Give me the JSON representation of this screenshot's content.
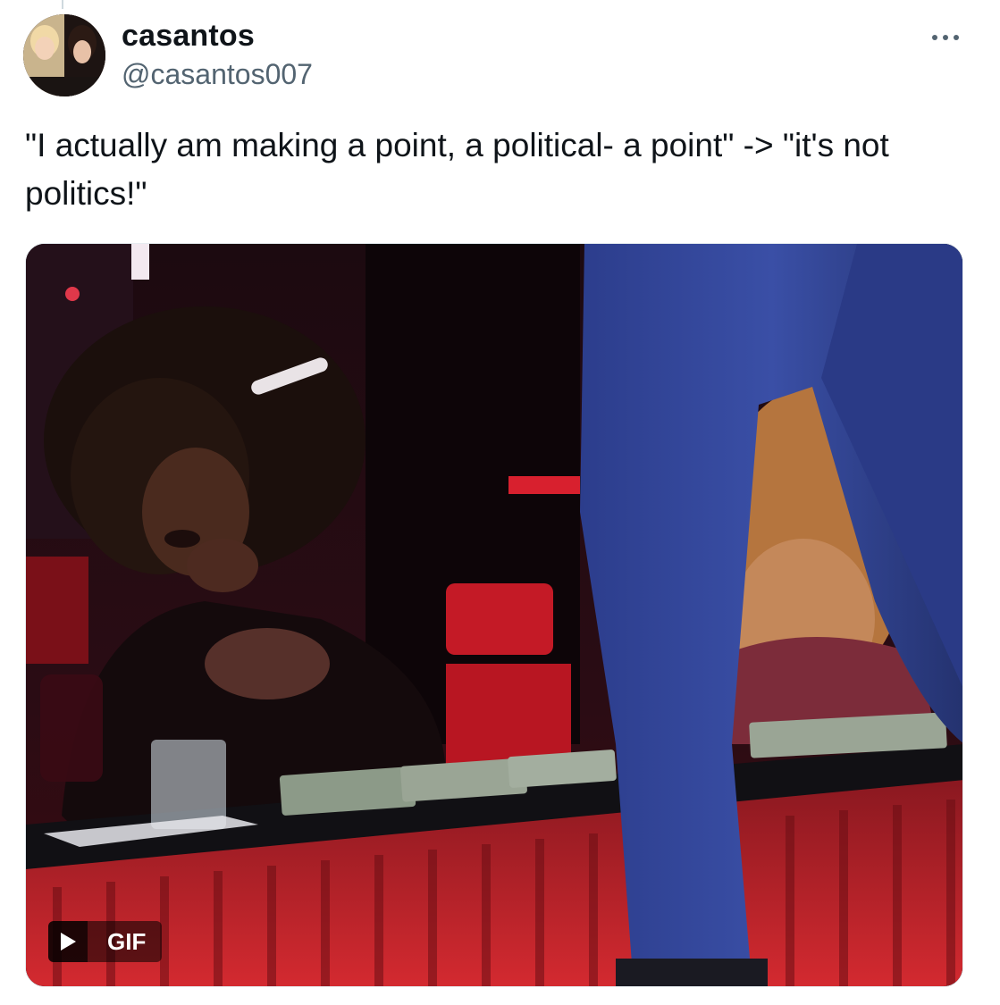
{
  "tweet": {
    "author": {
      "display_name": "casantos",
      "handle": "@casantos007",
      "avatar_icon": "profile-avatar"
    },
    "text": "\"I actually am making a point, a political- a point\" -> \"it's not politics!\"",
    "more_icon": "more-dots-icon",
    "media": {
      "type": "gif",
      "badge_label": "GIF",
      "play_icon": "play-icon"
    }
  },
  "colors": {
    "text_primary": "#0f1419",
    "text_secondary": "#536471",
    "background": "#ffffff"
  }
}
